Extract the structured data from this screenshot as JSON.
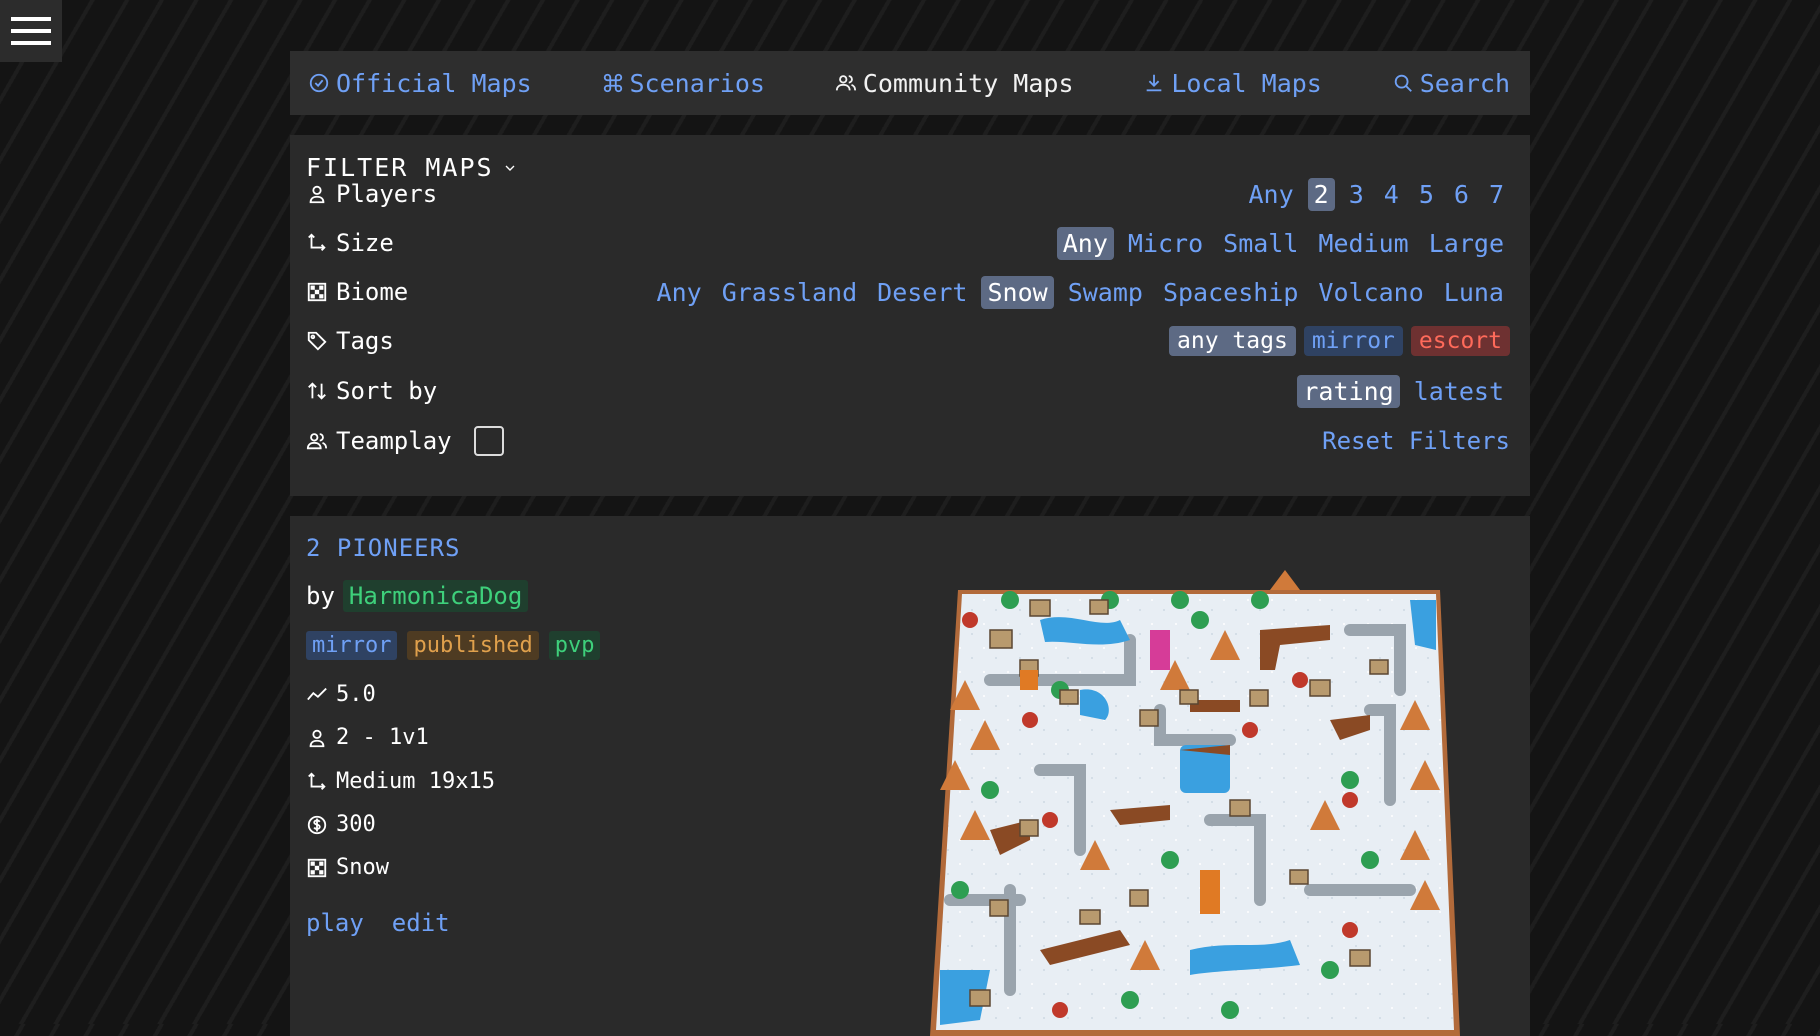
{
  "nav": {
    "tabs": [
      {
        "label": "Official Maps",
        "icon": "check-circle-icon",
        "active": false
      },
      {
        "label": "Scenarios",
        "icon": "command-icon",
        "active": false
      },
      {
        "label": "Community Maps",
        "icon": "users-icon",
        "active": true
      },
      {
        "label": "Local Maps",
        "icon": "download-icon",
        "active": false
      },
      {
        "label": "Search",
        "icon": "search-icon",
        "active": false
      }
    ]
  },
  "filters": {
    "title": "FILTER MAPS",
    "players": {
      "label": "Players",
      "options": [
        "Any",
        "2",
        "3",
        "4",
        "5",
        "6",
        "7"
      ],
      "selected": "2"
    },
    "size": {
      "label": "Size",
      "options": [
        "Any",
        "Micro",
        "Small",
        "Medium",
        "Large"
      ],
      "selected": "Any"
    },
    "biome": {
      "label": "Biome",
      "options": [
        "Any",
        "Grassland",
        "Desert",
        "Snow",
        "Swamp",
        "Spaceship",
        "Volcano",
        "Luna"
      ],
      "selected": "Snow"
    },
    "tags": {
      "label": "Tags",
      "options": [
        "any tags",
        "mirror",
        "escort"
      ]
    },
    "sort": {
      "label": "Sort by",
      "options": [
        "rating",
        "latest"
      ],
      "selected": "rating"
    },
    "teamplay": {
      "label": "Teamplay",
      "checked": false
    },
    "reset_label": "Reset Filters"
  },
  "map": {
    "title": "2 PIONEERS",
    "by_label": "by",
    "author": "HarmonicaDog",
    "tags": [
      "mirror",
      "published",
      "pvp"
    ],
    "rating": "5.0",
    "players": "2 - 1v1",
    "size": "Medium 19x15",
    "funds": "300",
    "biome": "Snow",
    "play_label": "play",
    "edit_label": "edit"
  },
  "colors": {
    "link": "#6fa0f5",
    "selected_bg": "#5d6a84",
    "panel_bg": "#2a2a2a",
    "author_green": "#3ed07b",
    "escort_red": "#ff6a5a"
  }
}
